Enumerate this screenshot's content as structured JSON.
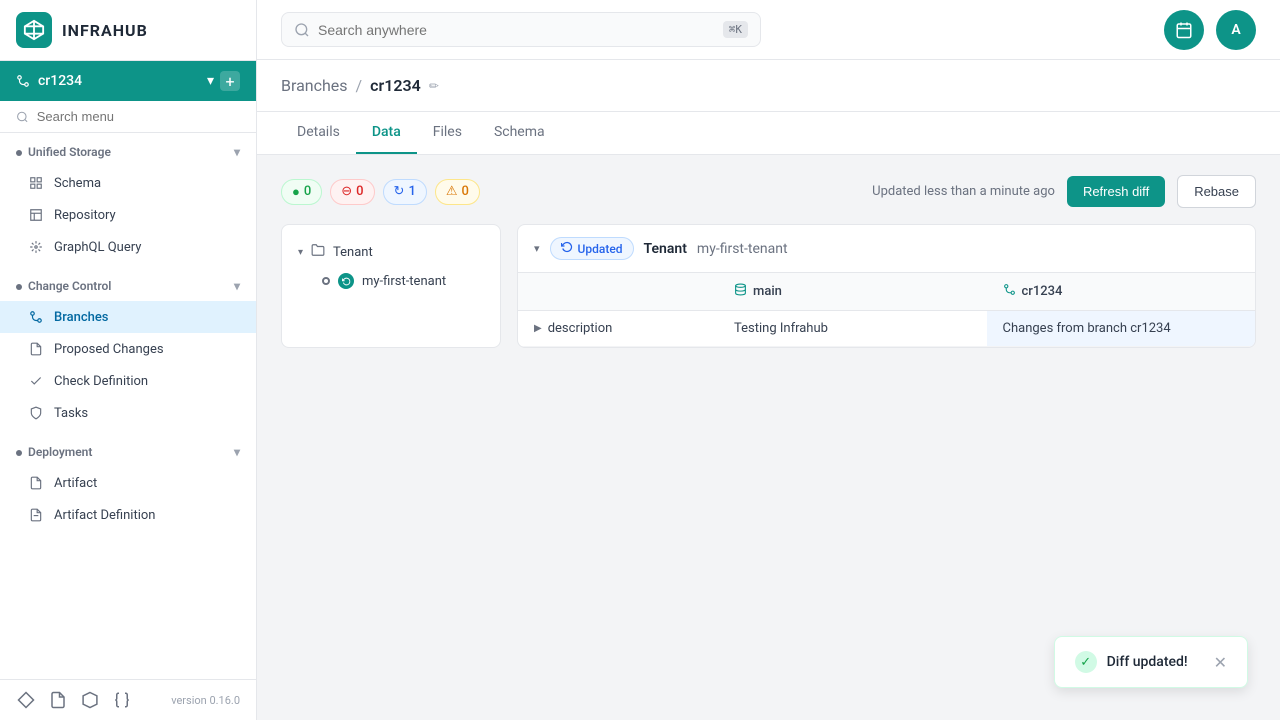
{
  "app": {
    "logo_text": "INFRAHUB",
    "version": "version 0.16.0"
  },
  "branch_selector": {
    "current": "cr1234",
    "chevron": "▾",
    "add": "+"
  },
  "sidebar": {
    "search_placeholder": "Search menu",
    "sections": [
      {
        "label": "Unified Storage",
        "items": [
          {
            "label": "Schema",
            "icon": "schema"
          },
          {
            "label": "Repository",
            "icon": "repo"
          },
          {
            "label": "GraphQL Query",
            "icon": "graphql"
          }
        ]
      },
      {
        "label": "Change Control",
        "items": [
          {
            "label": "Branches",
            "icon": "branches",
            "active": true
          },
          {
            "label": "Proposed Changes",
            "icon": "proposed"
          },
          {
            "label": "Check Definition",
            "icon": "check"
          },
          {
            "label": "Tasks",
            "icon": "tasks"
          }
        ]
      },
      {
        "label": "Deployment",
        "items": [
          {
            "label": "Artifact",
            "icon": "artifact"
          },
          {
            "label": "Artifact Definition",
            "icon": "artifact-def"
          }
        ]
      }
    ],
    "footer_icons": [
      "diamond",
      "document",
      "hexagon",
      "braces"
    ]
  },
  "navbar": {
    "search_placeholder": "Search anywhere",
    "search_kbd": "⌘K",
    "avatar_label": "A"
  },
  "breadcrumb": {
    "parent": "Branches",
    "separator": "/",
    "current": "cr1234"
  },
  "tabs": [
    {
      "label": "Details",
      "active": false
    },
    {
      "label": "Data",
      "active": true
    },
    {
      "label": "Files",
      "active": false
    },
    {
      "label": "Schema",
      "active": false
    }
  ],
  "diff": {
    "badges": [
      {
        "type": "added",
        "icon": "●",
        "count": "0"
      },
      {
        "type": "removed",
        "icon": "⊖",
        "count": "0"
      },
      {
        "type": "updated",
        "icon": "↻",
        "count": "1"
      },
      {
        "type": "conflict",
        "icon": "⚠",
        "count": "0"
      }
    ],
    "status_text": "Updated less than a minute ago",
    "refresh_label": "Refresh diff",
    "rebase_label": "Rebase",
    "tree": {
      "items": [
        {
          "label": "Tenant",
          "icon": "folder",
          "children": [
            {
              "label": "my-first-tenant"
            }
          ]
        }
      ]
    },
    "detail": {
      "status": "Updated",
      "entity_type": "Tenant",
      "entity_name": "my-first-tenant",
      "columns": [
        {
          "label": ""
        },
        {
          "label": "main",
          "icon": "stack"
        },
        {
          "label": "cr1234",
          "icon": "branch"
        }
      ],
      "rows": [
        {
          "field": "description",
          "main_value": "Testing Infrahub",
          "branch_value": "Changes from branch cr1234",
          "highlighted": true
        }
      ]
    }
  },
  "toast": {
    "text": "Diff updated!",
    "icon": "✓"
  }
}
